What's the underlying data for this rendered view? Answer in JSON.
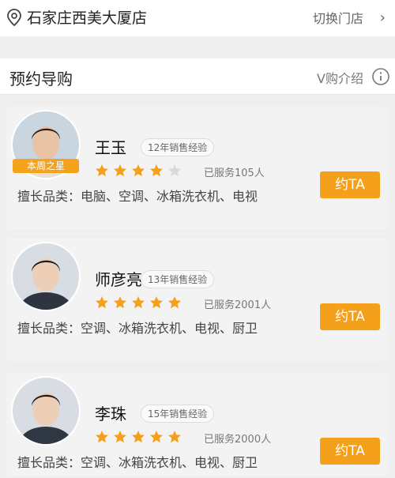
{
  "store": {
    "name": "石家庄西美大厦店",
    "switch_label": "切换门店"
  },
  "section": {
    "title": "预约导购",
    "intro_label": "V购介绍"
  },
  "colors": {
    "accent": "#f5a01a",
    "star_filled": "#f5a01a",
    "star_empty": "#d9d9d9",
    "background": "#efefef"
  },
  "advisors": [
    {
      "name": "王玉",
      "experience": "12年销售经验",
      "rating": 4,
      "served": "已服务105人",
      "specialty": "擅长品类：电脑、空调、冰箱洗衣机、电视",
      "badge": "本周之星",
      "button": "约TA"
    },
    {
      "name": "师彦亮",
      "experience": "13年销售经验",
      "rating": 5,
      "served": "已服务2001人",
      "specialty": "擅长品类：空调、冰箱洗衣机、电视、厨卫",
      "badge": "",
      "button": "约TA"
    },
    {
      "name": "李珠",
      "experience": "15年销售经验",
      "rating": 5,
      "served": "已服务2000人",
      "specialty": "擅长品类：空调、冰箱洗衣机、电视、厨卫",
      "badge": "",
      "button": "约TA"
    }
  ]
}
